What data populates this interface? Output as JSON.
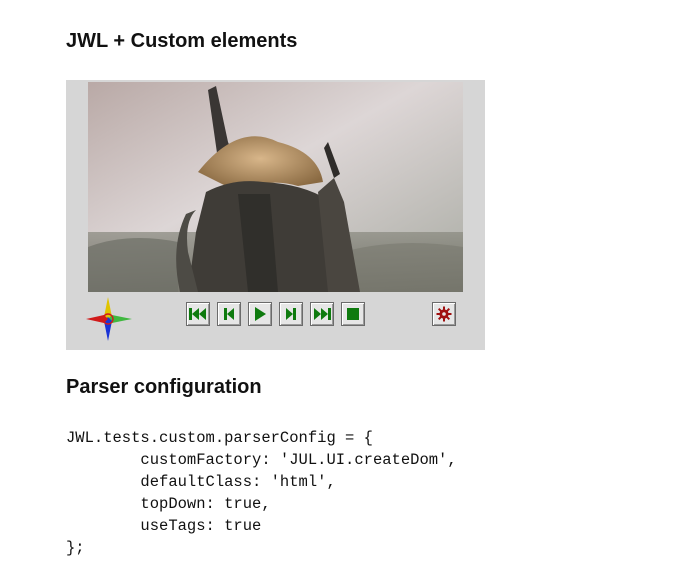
{
  "page": {
    "title": "JWL + Custom elements",
    "config_heading": "Parser configuration"
  },
  "player": {
    "controls": [
      {
        "name": "first-frame-button",
        "icon": "skip-first-icon"
      },
      {
        "name": "previous-frame-button",
        "icon": "step-back-icon"
      },
      {
        "name": "play-button",
        "icon": "play-icon"
      },
      {
        "name": "next-frame-button",
        "icon": "step-forward-icon"
      },
      {
        "name": "last-frame-button",
        "icon": "skip-last-icon"
      },
      {
        "name": "stop-button",
        "icon": "stop-icon"
      }
    ],
    "settings_icon": "gear-icon",
    "logo_icon": "compass-star-icon",
    "colors": {
      "background": "#d6d6d6",
      "control_icon": "#0e7a0e",
      "settings_icon": "#a01010"
    }
  },
  "code": {
    "lines": [
      "JWL.tests.custom.parserConfig = {",
      "        customFactory: 'JUL.UI.createDom',",
      "        defaultClass: 'html',",
      "        topDown: true,",
      "        useTags: true",
      "};"
    ]
  }
}
